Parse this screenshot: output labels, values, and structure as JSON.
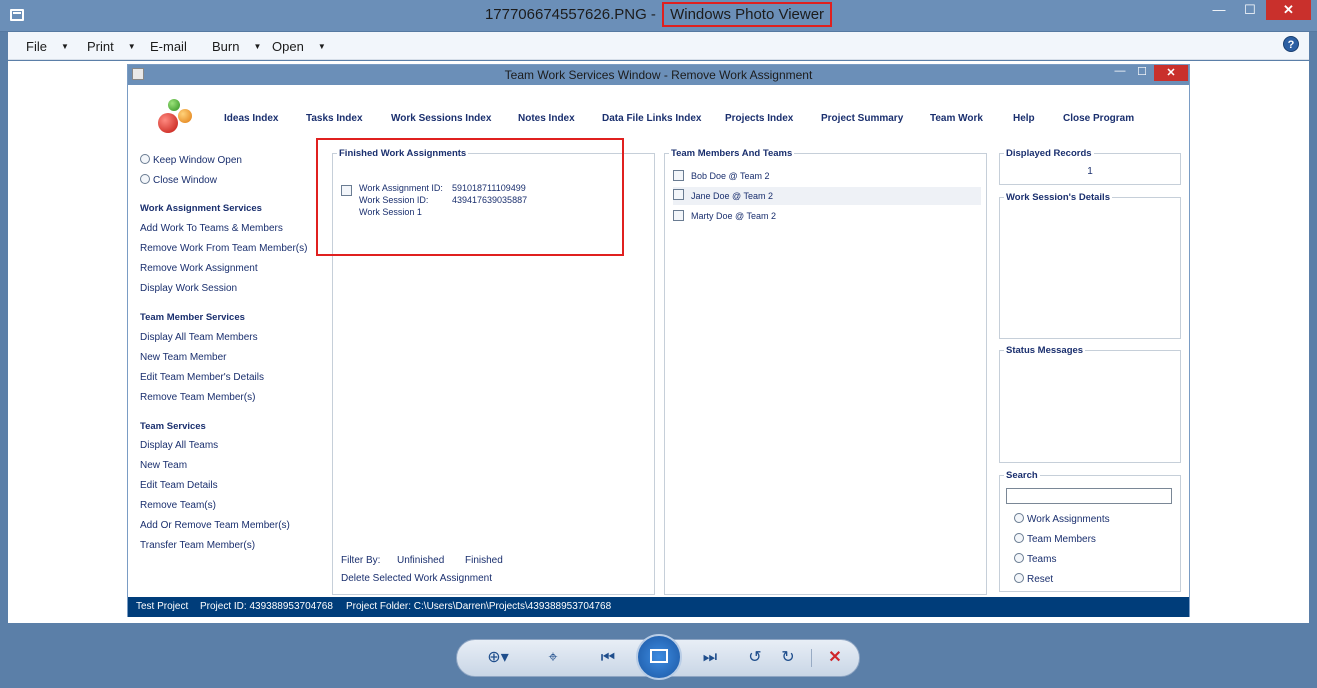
{
  "viewer": {
    "file_name": "177706674557626.PNG",
    "separator": " - ",
    "app_name": "Windows Photo Viewer",
    "controls": {
      "minimize": "—",
      "maximize": "☐",
      "close": "✕"
    },
    "menu": [
      {
        "label": "File"
      },
      {
        "label": "Print"
      },
      {
        "label": "E-mail"
      },
      {
        "label": "Burn"
      },
      {
        "label": "Open"
      }
    ],
    "help_label": "?",
    "toolbar_icons": [
      "zoom-icon",
      "actual-size-icon",
      "previous-icon",
      "slideshow-icon",
      "next-icon",
      "rotate-counterclockwise-icon",
      "rotate-clockwise-icon",
      "delete-icon"
    ]
  },
  "app": {
    "title": "Team Work Services Window - Remove Work Assignment",
    "controls": {
      "minimize": "—",
      "maximize": "☐",
      "close": "✕"
    },
    "nav": [
      "Ideas Index",
      "Tasks Index",
      "Work Sessions Index",
      "Notes Index",
      "Data File Links Index",
      "Projects Index",
      "Project Summary",
      "Team Work",
      "Help",
      "Close Program"
    ],
    "sidebar": {
      "keep_open": "Keep Window Open",
      "close_window": "Close Window",
      "work_assignment_services": {
        "heading": "Work Assignment Services",
        "items": [
          "Add Work To Teams & Members",
          "Remove Work From Team Member(s)",
          "Remove Work Assignment",
          "Display Work Session"
        ]
      },
      "team_member_services": {
        "heading": "Team Member Services",
        "items": [
          "Display All Team Members",
          "New Team Member",
          "Edit Team Member's Details",
          "Remove Team Member(s)"
        ]
      },
      "team_services": {
        "heading": "Team Services",
        "items": [
          "Display All Teams",
          "New Team",
          "Edit Team Details",
          "Remove Team(s)",
          "Add Or Remove Team Member(s)",
          "Transfer Team Member(s)"
        ]
      }
    },
    "finished": {
      "legend": "Finished Work Assignments",
      "item": {
        "assignment_label": "Work Assignment ID:",
        "assignment_id": "591018711109499",
        "session_label": "Work Session ID:",
        "session_id": "439417639035887",
        "session_name": "Work Session 1"
      },
      "filter_label": "Filter By:",
      "filter_unfinished": "Unfinished",
      "filter_finished": "Finished",
      "delete_label": "Delete Selected Work Assignment"
    },
    "members": {
      "legend": "Team Members And Teams",
      "items": [
        "Bob Doe @ Team 2",
        "Jane Doe @ Team 2",
        "Marty Doe @ Team 2"
      ]
    },
    "displayed_records": {
      "legend": "Displayed Records",
      "value": "1"
    },
    "session_details": {
      "legend": "Work Session's Details"
    },
    "status_messages": {
      "legend": "Status Messages"
    },
    "search": {
      "legend": "Search",
      "value": "",
      "options": [
        "Work Assignments",
        "Team Members",
        "Teams",
        "Reset"
      ]
    },
    "status_bar": {
      "project": "Test Project",
      "project_id": "Project ID:  439388953704768",
      "project_folder": "Project Folder:  C:\\Users\\Darren\\Projects\\439388953704768"
    }
  },
  "colors": {
    "title_bar": "#6b8fb8",
    "link_text": "#1a2f6e",
    "status_bar": "#003d7a",
    "highlight_box": "#e0201f",
    "close_button": "#c9302c"
  }
}
